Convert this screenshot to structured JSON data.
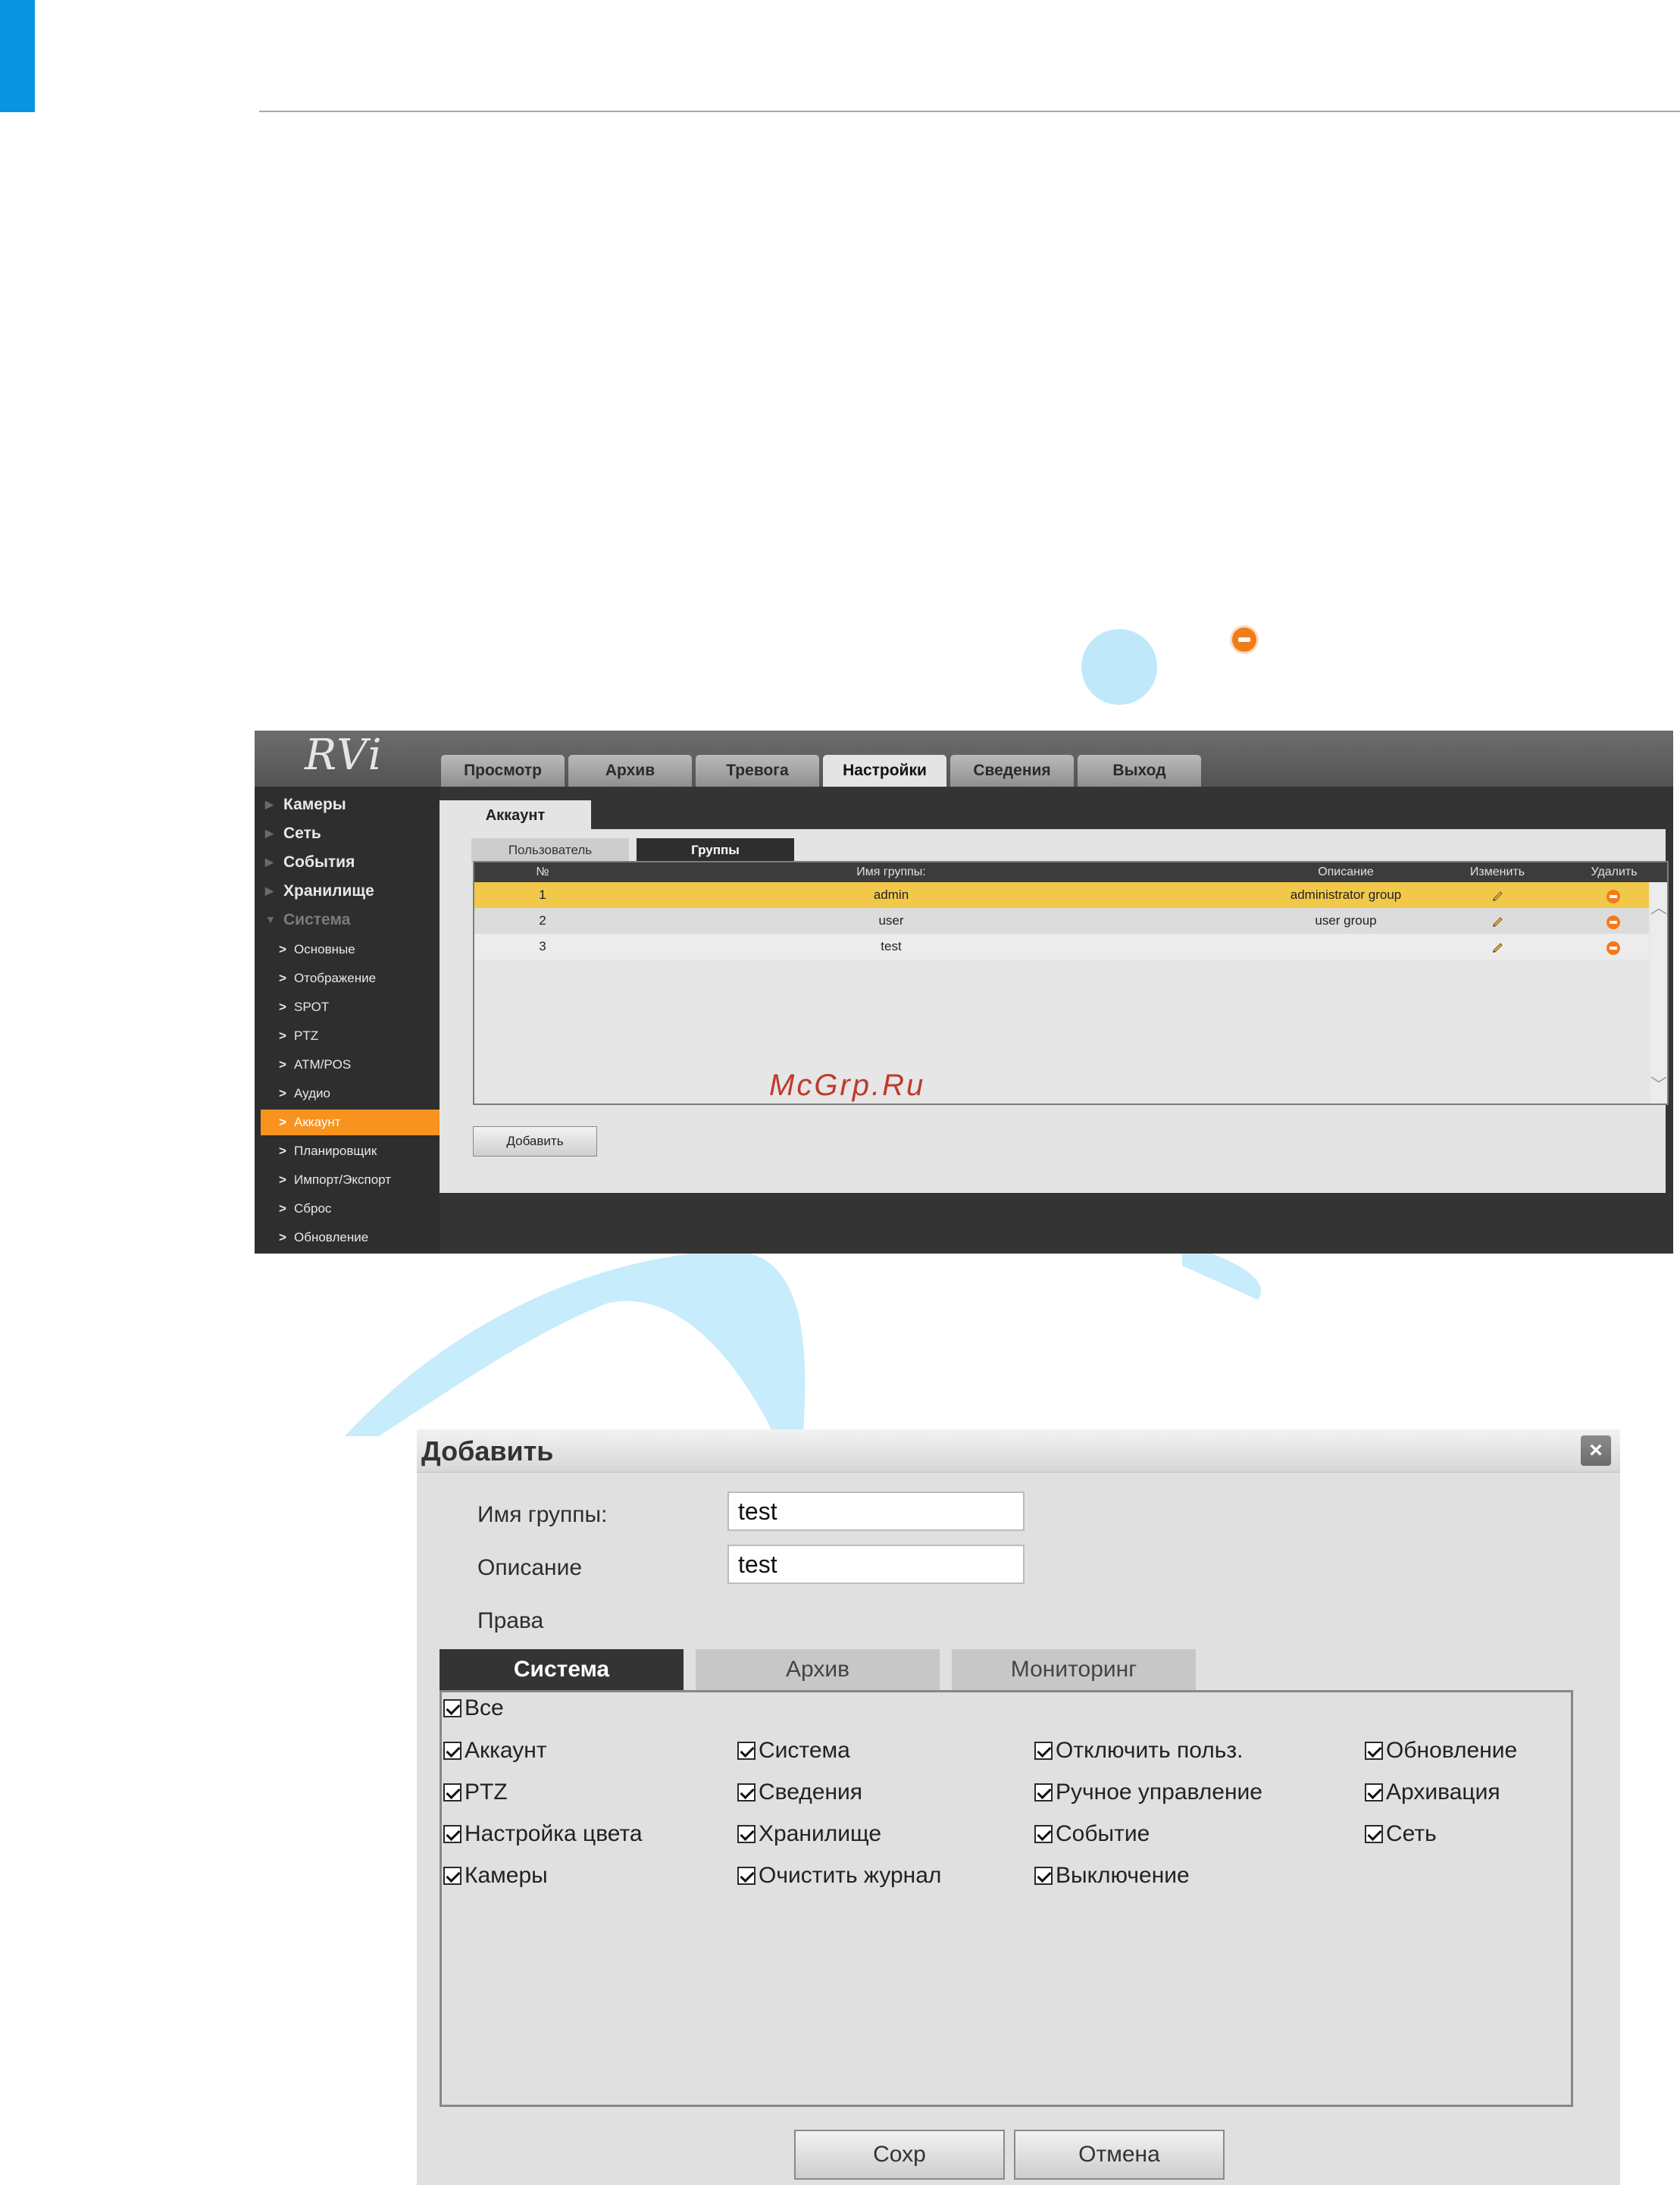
{
  "watermark": "McGrp.Ru",
  "app": {
    "logo": "RVi",
    "tabs": [
      "Просмотр",
      "Архив",
      "Тревога",
      "Настройки",
      "Сведения",
      "Выход"
    ],
    "active_tab": "Настройки"
  },
  "sidebar": {
    "main": [
      "Камеры",
      "Сеть",
      "События",
      "Хранилище",
      "Система"
    ],
    "sub": [
      "Основные",
      "Отображение",
      "SPOT",
      "PTZ",
      "ATM/POS",
      "Аудио",
      "Аккаунт",
      "Планировщик",
      "Импорт/Экспорт",
      "Сброс",
      "Обновление"
    ],
    "active_sub": "Аккаунт"
  },
  "account": {
    "tab": "Аккаунт",
    "subtabs": [
      "Пользователь",
      "Группы"
    ],
    "table": {
      "headers": [
        "№",
        "Имя группы:",
        "Описание",
        "Изменить",
        "Удалить"
      ],
      "rows": [
        {
          "no": "1",
          "name": "admin",
          "desc": "administrator group"
        },
        {
          "no": "2",
          "name": "user",
          "desc": "user group"
        },
        {
          "no": "3",
          "name": "test",
          "desc": ""
        }
      ]
    },
    "add_button": "Добавить"
  },
  "dialog": {
    "title": "Добавить",
    "group_name_label": "Имя группы:",
    "group_name_value": "test",
    "description_label": "Описание",
    "description_value": "test",
    "rights_label": "Права",
    "tabs": [
      "Система",
      "Архив",
      "Мониторинг"
    ],
    "all_label": "Все",
    "permissions": [
      [
        "Аккаунт",
        "Система",
        "Отключить польз.",
        "Обновление"
      ],
      [
        "PTZ",
        "Сведения",
        "Ручное управление",
        "Архивация"
      ],
      [
        "Настройка цвета",
        "Хранилище",
        "Событие",
        "Сеть"
      ],
      [
        "Камеры",
        "Очистить журнал",
        "Выключение",
        ""
      ]
    ],
    "save_button": "Сохр",
    "cancel_button": "Отмена"
  }
}
